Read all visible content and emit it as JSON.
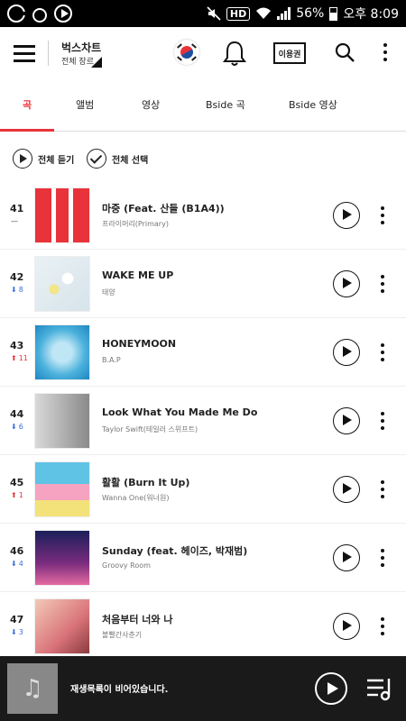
{
  "status_bar": {
    "battery": "56%",
    "time": "오후 8:09",
    "hd_badge": "HD",
    "icons": [
      "g-icon",
      "o-icon",
      "play-icon",
      "mute-icon",
      "hd-icon",
      "wifi-icon",
      "signal-icon",
      "battery-icon"
    ]
  },
  "header": {
    "title": "벅스차트",
    "subtitle": "전체 장르",
    "ticket_label": "이용권",
    "icons": [
      "menu-icon",
      "korea-flag-icon",
      "bell-icon",
      "ticket-icon",
      "search-icon",
      "more-icon"
    ]
  },
  "tabs": [
    {
      "label": "곡",
      "active": true
    },
    {
      "label": "앨범",
      "active": false
    },
    {
      "label": "영상",
      "active": false
    },
    {
      "label": "Bside 곡",
      "active": false
    },
    {
      "label": "Bside 영상",
      "active": false
    }
  ],
  "actions": {
    "play_all": "전체 듣기",
    "select_all": "전체 선택"
  },
  "tracks": [
    {
      "rank": "41",
      "change_dir": "same",
      "change": "",
      "title": "마중 (Feat. 산들 (B1A4))",
      "artist": "프라이머리(Primary)",
      "art": "pop"
    },
    {
      "rank": "42",
      "change_dir": "down",
      "change": "8",
      "title": "WAKE ME UP",
      "artist": "태양",
      "art": "flowers"
    },
    {
      "rank": "43",
      "change_dir": "up",
      "change": "11",
      "title": "HONEYMOON",
      "artist": "B.A.P",
      "art": "blue"
    },
    {
      "rank": "44",
      "change_dir": "down",
      "change": "6",
      "title": "Look What You Made Me Do",
      "artist": "Taylor Swift(테일러 스위프트)",
      "art": "reputation"
    },
    {
      "rank": "45",
      "change_dir": "up",
      "change": "1",
      "title": "활활 (Burn It Up)",
      "artist": "Wanna One(워너원)",
      "art": "group"
    },
    {
      "rank": "46",
      "change_dir": "down",
      "change": "4",
      "title": "Sunday (feat. 헤이즈, 박재범)",
      "artist": "Groovy Room",
      "art": "night"
    },
    {
      "rank": "47",
      "change_dir": "down",
      "change": "3",
      "title": "처음부터 너와 나",
      "artist": "볼빨간사춘기",
      "art": "drama"
    }
  ],
  "player": {
    "empty_text": "재생목록이 비어있습니다.",
    "icons": [
      "music-note-icon",
      "play-icon",
      "queue-icon"
    ]
  },
  "colors": {
    "accent": "#e8333a",
    "rank_down": "#3c6fd6",
    "rank_up": "#e8333a",
    "player_bg": "#1a1a1a"
  }
}
